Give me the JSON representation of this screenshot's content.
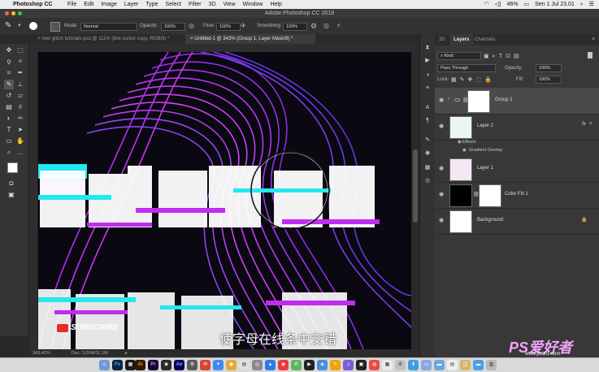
{
  "menubar": {
    "app_name": "Photoshop CC",
    "menus": [
      "File",
      "Edit",
      "Image",
      "Layer",
      "Type",
      "Select",
      "Filter",
      "3D",
      "View",
      "Window",
      "Help"
    ],
    "battery": "46%",
    "clock": "Sen 1 Jul 23.01"
  },
  "window": {
    "title": "Adobe Photoshop CC 2018"
  },
  "options_bar": {
    "mode_label": "Mode:",
    "mode_value": "Normal",
    "opacity_label": "Opacity:",
    "opacity_value": "100%",
    "flow_label": "Flow:",
    "flow_value": "100%",
    "smoothing_label": "Smoothing:",
    "smoothing_value": "100%"
  },
  "doc_tabs": [
    {
      "label": "new glitch tutorials.psd @ 111% (line contur copy, RGB/8) *"
    },
    {
      "label": "Untitled-1 @ 343% (Group 1, Layer Mask/8) *"
    }
  ],
  "status_bar": {
    "zoom": "343,42%",
    "doc": "Doc: 3,00M/11,1M"
  },
  "panel": {
    "tabs": [
      "3D",
      "Layers",
      "Channels"
    ],
    "filter_kind": "Kind",
    "blend_mode": "Pass Through",
    "opacity_label": "Opacity:",
    "opacity_value": "100%",
    "lock_label": "Lock:",
    "fill_label": "Fill:",
    "fill_value": "100%",
    "layers": [
      {
        "name": "Group 1"
      },
      {
        "name": "Layer 2"
      },
      {
        "name": "Layer 1"
      },
      {
        "name": "Color Fill 1"
      },
      {
        "name": "Background"
      }
    ],
    "effects_label": "Effects",
    "effect_item": "Gradient Overlay",
    "fx_badge": "fx"
  },
  "canvas": {
    "subscribe_label": "SUBSCRIBE",
    "subtitle": "使字母在线条中交错"
  },
  "watermark": {
    "brand": "PS爱好者",
    "url": "www.psahz.com"
  },
  "colors": {
    "magenta": "#c02cf0",
    "cyan": "#22e8f0",
    "panel_bg": "#383838",
    "canvas_bg": "#0a0810"
  }
}
